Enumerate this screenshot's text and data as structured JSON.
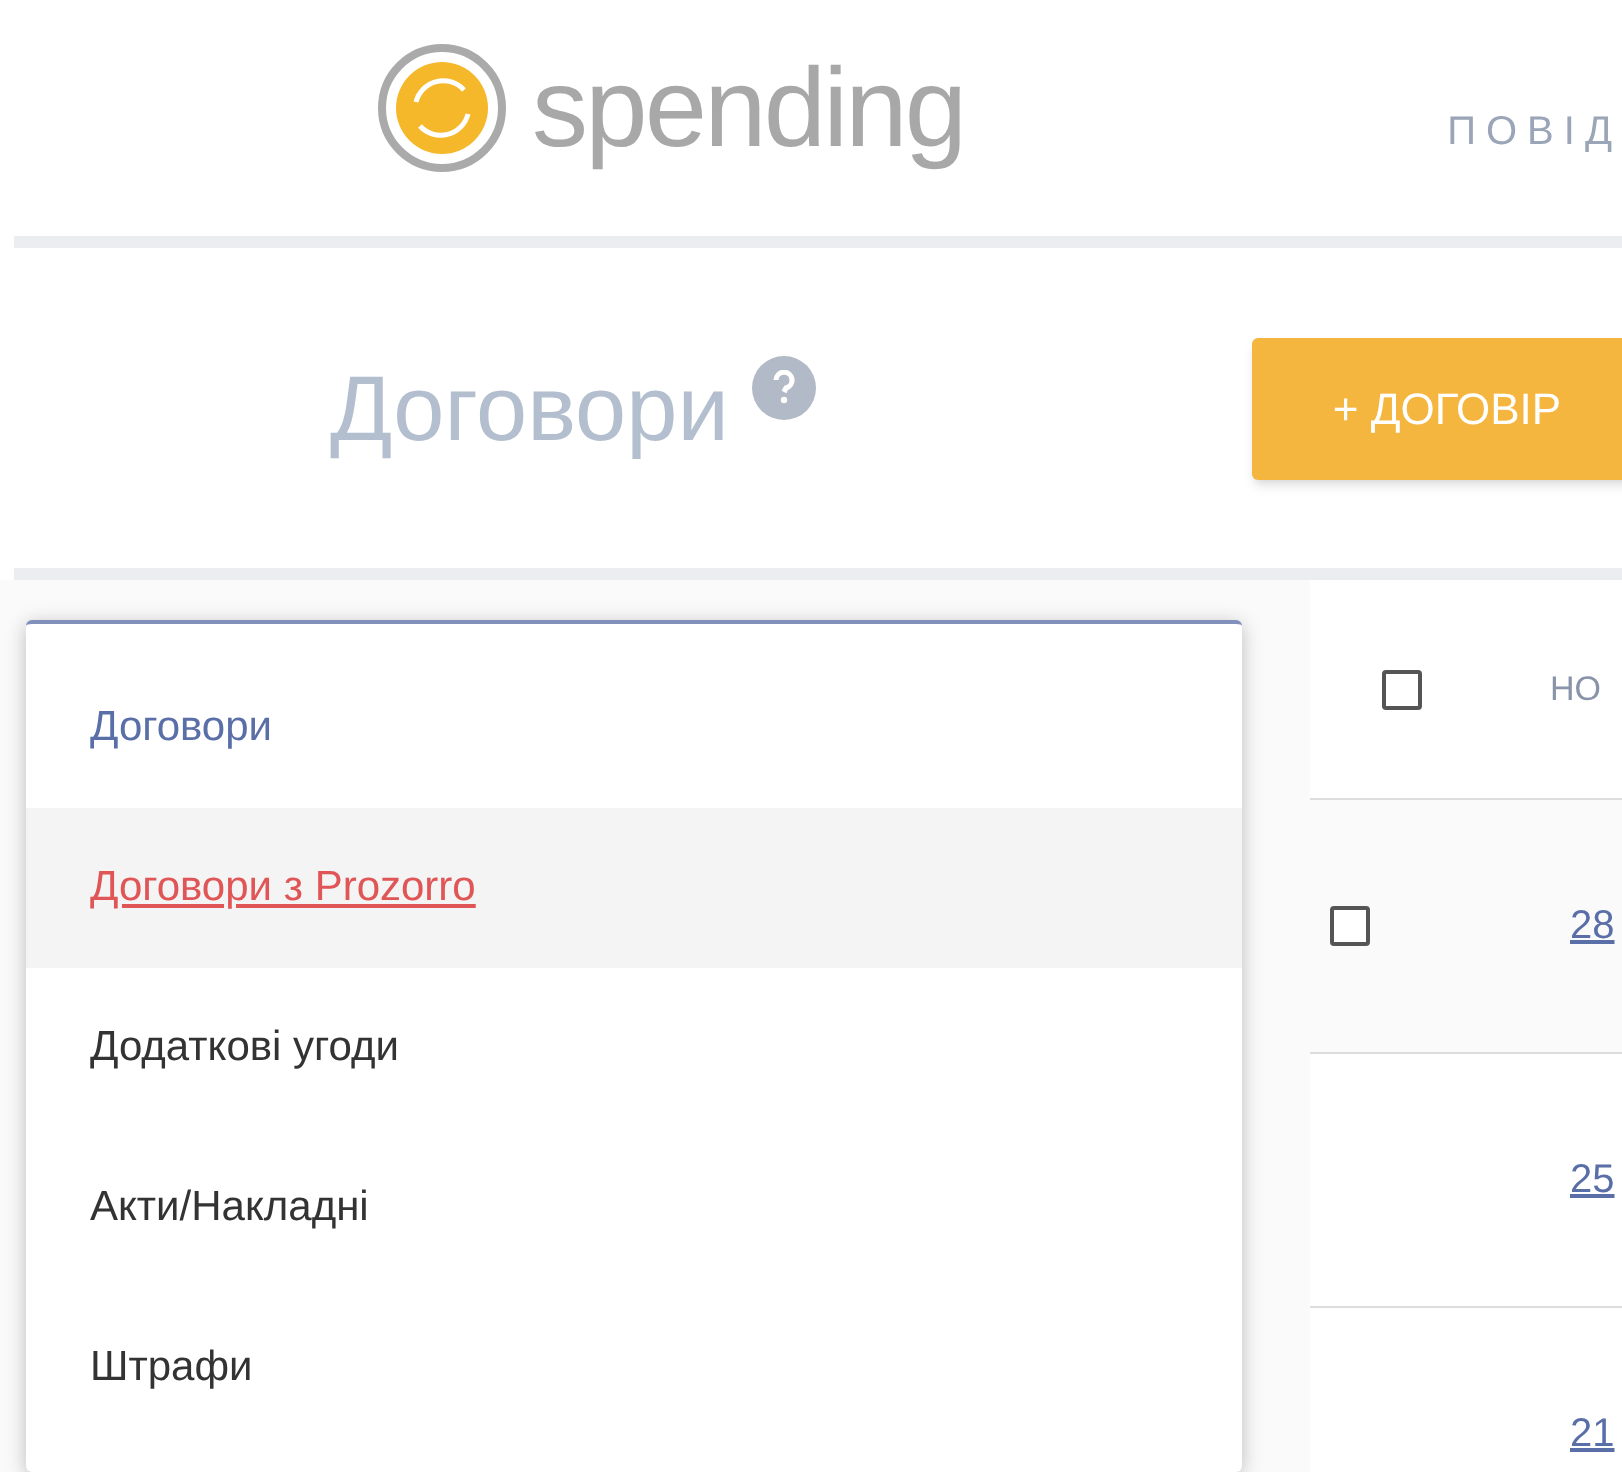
{
  "header": {
    "logo_text": "spending",
    "nav_item": "ПОВІД"
  },
  "page": {
    "title": "Договори",
    "add_button": "+ ДОГОВІР"
  },
  "table": {
    "header": {
      "checked": false,
      "column_2": "НО"
    },
    "rows": [
      {
        "kind": "checkbox",
        "checked": false,
        "number": "28"
      },
      {
        "kind": "plain",
        "number": "25"
      },
      {
        "kind": "plain",
        "number": "21"
      }
    ]
  },
  "dropdown": {
    "items": [
      {
        "label": "Договори",
        "selected": true,
        "highlighted": false
      },
      {
        "label": "Договори з Prozorro",
        "selected": false,
        "highlighted": true
      },
      {
        "label": "Додаткові угоди",
        "selected": false,
        "highlighted": false
      },
      {
        "label": "Акти/Накладні",
        "selected": false,
        "highlighted": false
      },
      {
        "label": "Штрафи",
        "selected": false,
        "highlighted": false
      }
    ]
  }
}
